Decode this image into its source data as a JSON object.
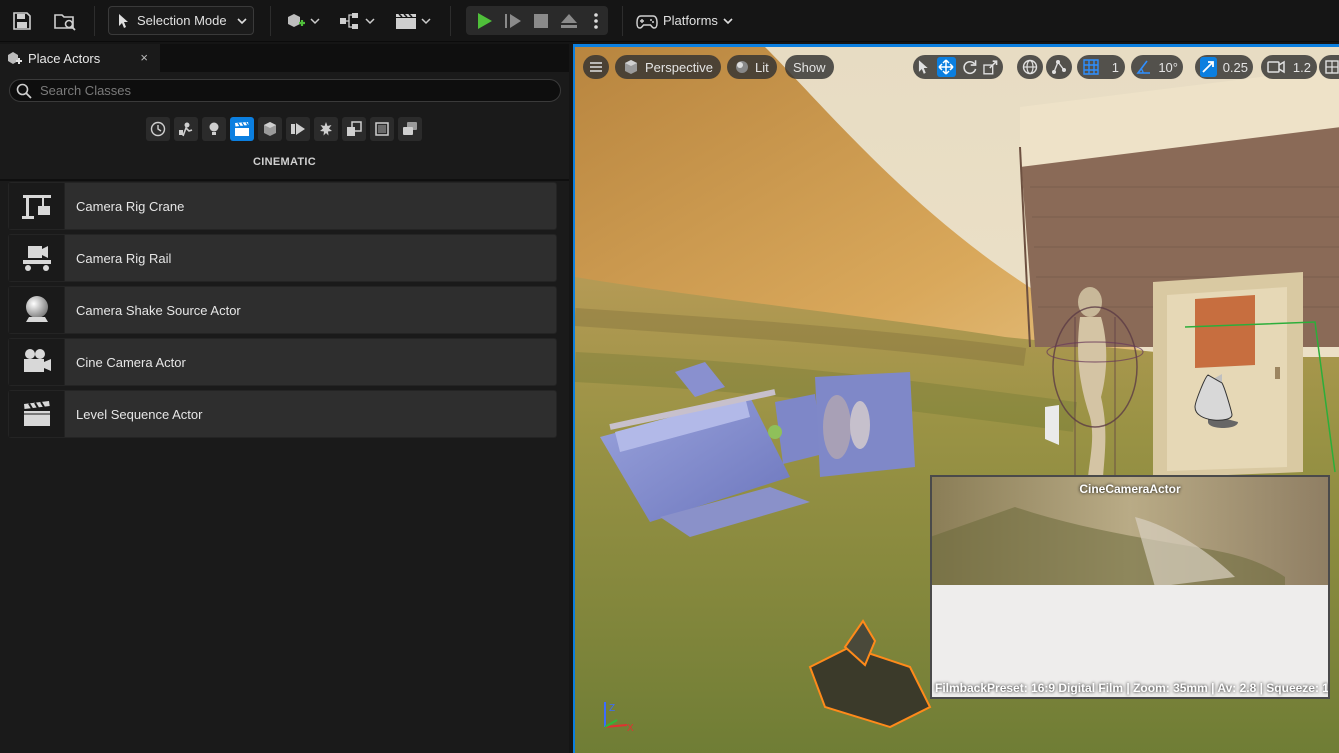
{
  "toolbar": {
    "selection_mode": "Selection Mode",
    "platforms": "Platforms"
  },
  "panel": {
    "tab_title": "Place Actors",
    "close_glyph": "×",
    "search_placeholder": "Search Classes",
    "category_title": "CINEMATIC",
    "categories": [
      "recent-icon",
      "basic-icon",
      "lights-icon",
      "cinematic-icon",
      "visual-effects-icon",
      "geometry-icon",
      "volumes-icon",
      "all-classes-icon",
      "shapes-icon",
      "more-icon",
      "layers-icon"
    ],
    "items": [
      {
        "label": "Camera Rig Crane",
        "icon": "crane-icon"
      },
      {
        "label": "Camera Rig Rail",
        "icon": "rail-icon"
      },
      {
        "label": "Camera Shake Source Actor",
        "icon": "shake-source-icon"
      },
      {
        "label": "Cine Camera Actor",
        "icon": "cine-camera-icon"
      },
      {
        "label": "Level Sequence Actor",
        "icon": "clapperboard-icon"
      }
    ]
  },
  "viewport": {
    "view_mode": "Perspective",
    "lighting": "Lit",
    "show": "Show",
    "grid_size": "1",
    "rotation_snap": "10°",
    "scale_snap": "0.25",
    "camera_speed": "1.2",
    "pip_title": "CineCameraActor",
    "pip_info": "FilmbackPreset: 16:9 Digital Film | Zoom: 35mm | Av: 2.8 | Squeeze: 1"
  },
  "colors": {
    "accent": "#0b7fe0",
    "play": "#4fbf3a"
  }
}
